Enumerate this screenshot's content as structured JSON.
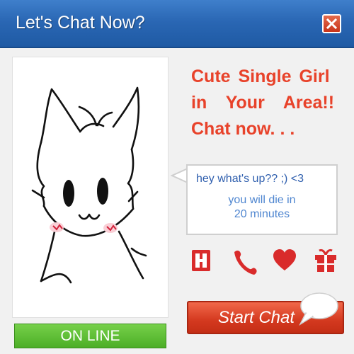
{
  "window": {
    "title": "Let's Chat Now?",
    "close_icon": "close-x-icon"
  },
  "profile": {
    "photo": "cartoon-cat-image",
    "status": "ON LINE",
    "status_color": "#5cbf33"
  },
  "promo": {
    "line1": "Cute Single Girl",
    "line2": "in Your Area!!",
    "line3": "Chat now. . .",
    "color": "#e8422a"
  },
  "message": {
    "line1": "hey what's up?? ;) <3",
    "line2": "you will die in",
    "line3": "20 minutes"
  },
  "actions": {
    "icons": [
      "block-icon",
      "phone-icon",
      "heart-icon",
      "gift-icon"
    ],
    "start_label": "Start Chat",
    "start_icon": "speech-bubble-icon",
    "accent": "#e0452a"
  }
}
